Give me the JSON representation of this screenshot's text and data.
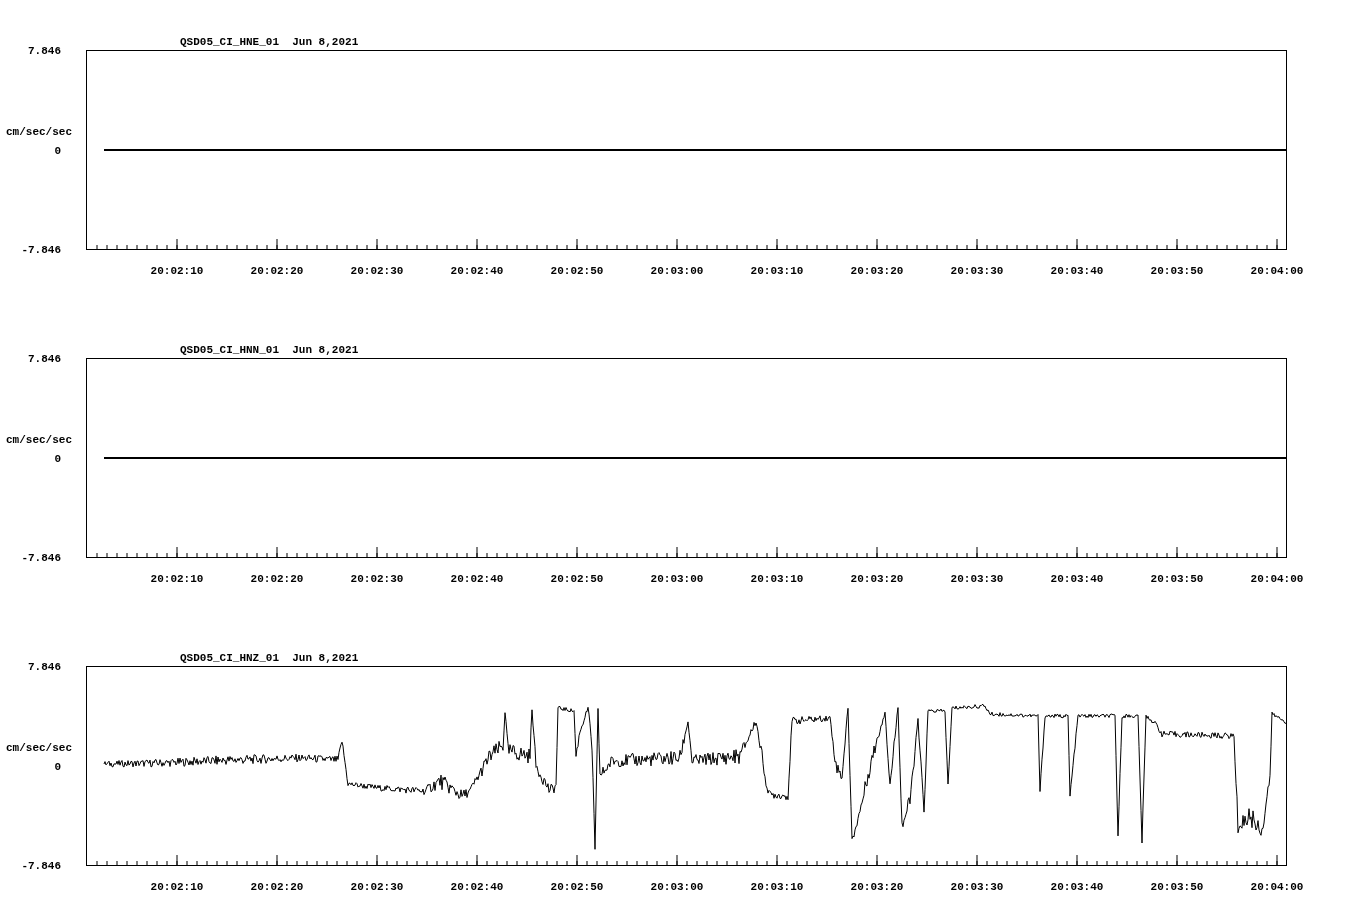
{
  "plots": [
    {
      "title": "QSD05_CI_HNE_01  Jun 8,2021",
      "ylabel": "cm/sec/sec",
      "yticks": [
        "7.846",
        "0",
        "-7.846"
      ],
      "xticks": [
        "20:02:10",
        "20:02:20",
        "20:02:30",
        "20:02:40",
        "20:02:50",
        "20:03:00",
        "20:03:10",
        "20:03:20",
        "20:03:30",
        "20:03:40",
        "20:03:50",
        "20:04:00"
      ],
      "kind": "flat"
    },
    {
      "title": "QSD05_CI_HNN_01  Jun 8,2021",
      "ylabel": "cm/sec/sec",
      "yticks": [
        "7.846",
        "0",
        "-7.846"
      ],
      "xticks": [
        "20:02:10",
        "20:02:20",
        "20:02:30",
        "20:02:40",
        "20:02:50",
        "20:03:00",
        "20:03:10",
        "20:03:20",
        "20:03:30",
        "20:03:40",
        "20:03:50",
        "20:04:00"
      ],
      "kind": "flat"
    },
    {
      "title": "QSD05_CI_HNZ_01  Jun 8,2021",
      "ylabel": "cm/sec/sec",
      "yticks": [
        "7.846",
        "0",
        "-7.846"
      ],
      "xticks": [
        "20:02:10",
        "20:02:20",
        "20:02:30",
        "20:02:40",
        "20:02:50",
        "20:03:00",
        "20:03:10",
        "20:03:20",
        "20:03:30",
        "20:03:40",
        "20:03:50",
        "20:04:00"
      ],
      "kind": "active"
    }
  ]
}
